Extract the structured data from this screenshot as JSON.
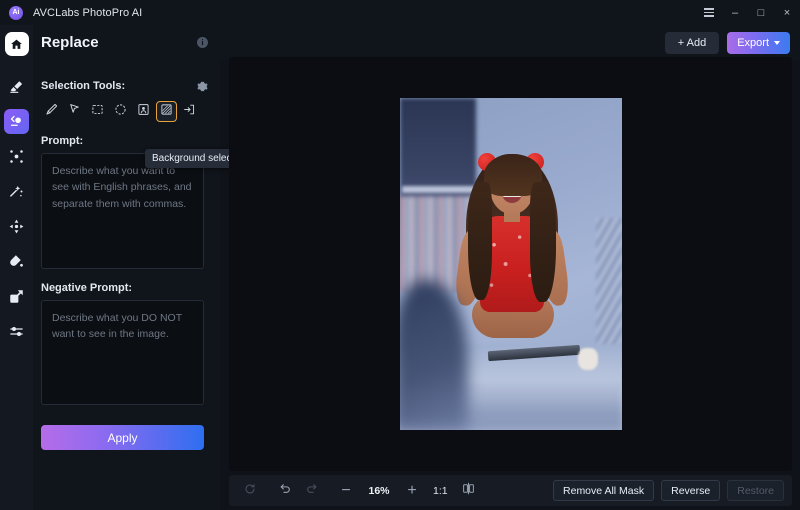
{
  "titlebar": {
    "app_name": "AVCLabs PhotoPro AI",
    "logo_text": "Ai",
    "menu_icon": "hamburger-menu-icon",
    "minimize_label": "–",
    "maximize_label": "□",
    "close_label": "×"
  },
  "rail": {
    "items": [
      {
        "name": "home",
        "icon": "home-icon",
        "active": false
      },
      {
        "name": "erase",
        "icon": "eraser-icon",
        "active": false
      },
      {
        "name": "replace",
        "icon": "replace-face-icon",
        "active": true
      },
      {
        "name": "enhance",
        "icon": "enhance-sparkle-icon",
        "active": false
      },
      {
        "name": "retouch",
        "icon": "magic-wand-icon",
        "active": false
      },
      {
        "name": "expand",
        "icon": "expand-arrows-icon",
        "active": false
      },
      {
        "name": "colorize",
        "icon": "paint-drop-icon",
        "active": false
      },
      {
        "name": "upscale",
        "icon": "resize-corner-icon",
        "active": false
      },
      {
        "name": "adjust",
        "icon": "sliders-icon",
        "active": false
      }
    ]
  },
  "panel": {
    "title": "Replace",
    "info_label": "i",
    "selection_tools_label": "Selection Tools:",
    "settings_icon": "gear-icon",
    "tools": [
      {
        "name": "brush-tool",
        "icon": "brush-icon",
        "selected": false
      },
      {
        "name": "lasso-tool",
        "icon": "cursor-arrow-icon",
        "selected": false
      },
      {
        "name": "rectangle-select-tool",
        "icon": "rectangle-icon",
        "selected": false
      },
      {
        "name": "ellipse-select-tool",
        "icon": "ellipse-icon",
        "selected": false
      },
      {
        "name": "subject-selection-tool",
        "icon": "person-portrait-icon",
        "selected": false
      },
      {
        "name": "background-selection-tool",
        "icon": "background-hatch-icon",
        "selected": true
      },
      {
        "name": "import-selection-tool",
        "icon": "arrow-into-box-icon",
        "selected": false
      }
    ],
    "tooltip": "Background selection tool",
    "prompt_label": "Prompt:",
    "prompt_value": "",
    "prompt_placeholder": "Describe what you want to see with English phrases, and separate them with commas.",
    "negative_prompt_label": "Negative Prompt:",
    "negative_prompt_value": "",
    "negative_prompt_placeholder": "Describe what you DO NOT want to see in the image.",
    "apply_label": "Apply"
  },
  "topbar": {
    "add_label": "+ Add",
    "export_label": "Export",
    "export_chevron": "chevron-down-icon"
  },
  "canvas": {
    "image_alt": "girl-with-red-pom-headband-sitting-on-bed-photo"
  },
  "bottombar": {
    "reset_icon": "reset-rotate-icon",
    "undo_icon": "undo-arrow-icon",
    "redo_icon": "redo-arrow-icon",
    "zoom_out_label": "−",
    "zoom_value": "16%",
    "zoom_in_label": "+",
    "fit_ratio_label": "1:1",
    "compare_icon": "split-compare-icon",
    "remove_all_mask_label": "Remove All Mask",
    "reverse_label": "Reverse",
    "restore_label": "Restore"
  },
  "colors": {
    "accent_purple": "#8b5cf6",
    "accent_blue": "#2f6ef0",
    "selected_tool_border": "#e8a33d",
    "panel_bg": "#10141b",
    "rail_bg": "#141921",
    "canvas_bg": "#0b0d12"
  }
}
